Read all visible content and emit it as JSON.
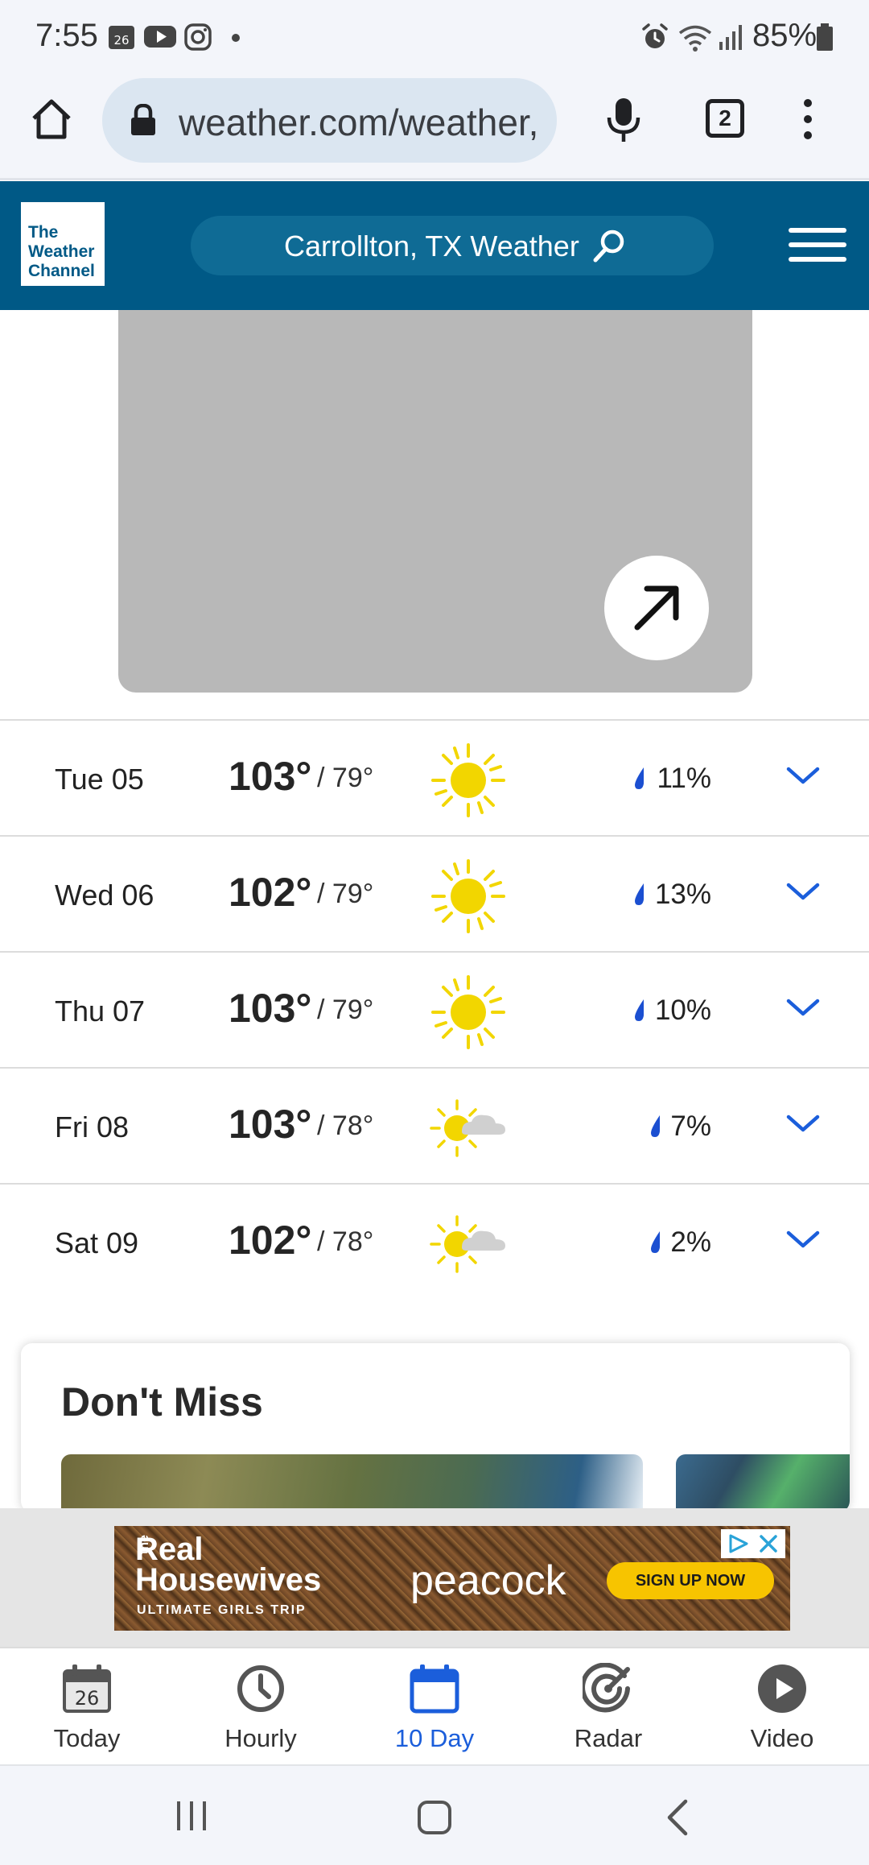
{
  "status_bar": {
    "time": "7:55",
    "calendar_badge": "26",
    "battery_percent": "85%"
  },
  "browser": {
    "url": "weather.com/weather,",
    "tab_count": "2"
  },
  "header": {
    "logo_lines": [
      "The",
      "Weather",
      "Channel"
    ],
    "search_label": "Carrollton, TX Weather"
  },
  "forecast": [
    {
      "day": "Tue 05",
      "high": "103°",
      "low": "79°",
      "condition": "sunny-icon",
      "precip": "11%"
    },
    {
      "day": "Wed 06",
      "high": "102°",
      "low": "79°",
      "condition": "sunny-icon",
      "precip": "13%"
    },
    {
      "day": "Thu 07",
      "high": "103°",
      "low": "79°",
      "condition": "sunny-icon",
      "precip": "10%"
    },
    {
      "day": "Fri 08",
      "high": "103°",
      "low": "78°",
      "condition": "mostly-sunny-icon",
      "precip": "7%"
    },
    {
      "day": "Sat 09",
      "high": "102°",
      "low": "78°",
      "condition": "mostly-sunny-icon",
      "precip": "2%"
    }
  ],
  "dont_miss": {
    "title": "Don't Miss"
  },
  "ad": {
    "show_title_line1": "Real",
    "show_title_line2": "Housewives",
    "show_prefix": "the",
    "show_subtitle": "ULTIMATE GIRLS TRIP",
    "brand": "peacock",
    "cta": "SIGN UP NOW"
  },
  "bottom_nav": {
    "items": [
      {
        "label": "Today",
        "badge": "26"
      },
      {
        "label": "Hourly"
      },
      {
        "label": "10 Day"
      },
      {
        "label": "Radar"
      },
      {
        "label": "Video"
      }
    ],
    "active_index": 2
  },
  "colors": {
    "brand_blue": "#005986",
    "accent_blue": "#1b5edb",
    "sun_yellow": "#f2d600",
    "cta_yellow": "#f7c400"
  }
}
